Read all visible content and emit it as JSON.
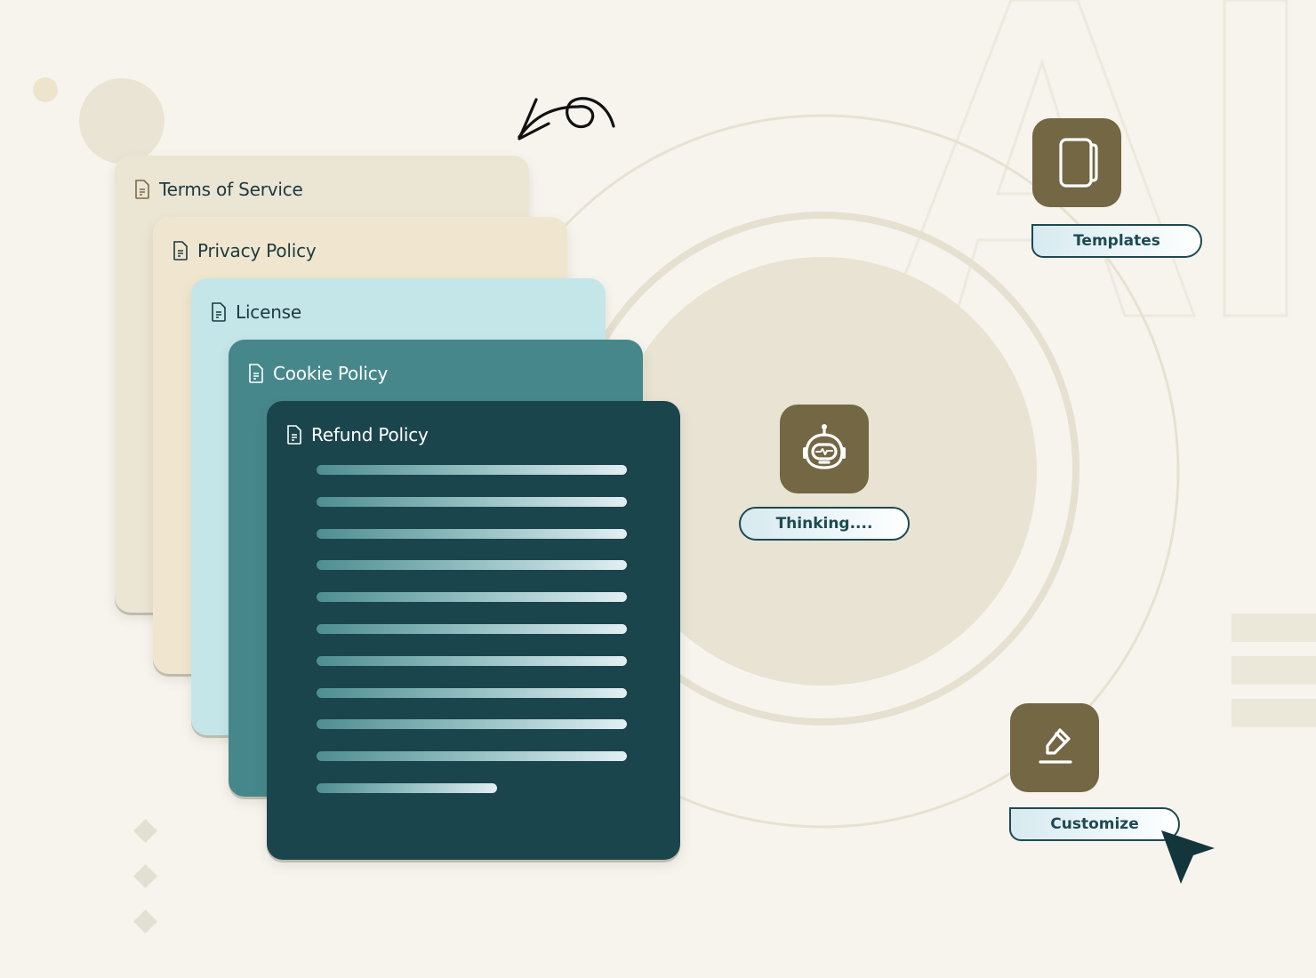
{
  "documents": [
    {
      "title": "Terms of Service",
      "icon": "document-icon",
      "color": "#ebe5d3",
      "text_color": "#1c3a40"
    },
    {
      "title": "Privacy Policy",
      "icon": "document-icon",
      "color": "#f0e6cf",
      "text_color": "#1c3a40"
    },
    {
      "title": "License",
      "icon": "document-icon",
      "color": "#c5e6e9",
      "text_color": "#1c3a40"
    },
    {
      "title": "Cookie Policy",
      "icon": "document-icon",
      "color": "#46878b",
      "text_color": "#ffffff"
    },
    {
      "title": "Refund Policy",
      "icon": "document-icon",
      "color": "#1b454d",
      "text_color": "#ffffff"
    }
  ],
  "refund_policy_text_lines": 11,
  "actions": {
    "templates": {
      "label": "Templates",
      "icon": "templates-icon"
    },
    "thinking": {
      "label": "Thinking....",
      "icon": "robot-icon"
    },
    "customize": {
      "label": "Customize",
      "icon": "pencil-icon"
    }
  },
  "background_watermark": "AI",
  "colors": {
    "background": "#f6f4ed",
    "tile": "#736744",
    "accent_dark": "#1d4a52",
    "cursor": "#12363c"
  }
}
